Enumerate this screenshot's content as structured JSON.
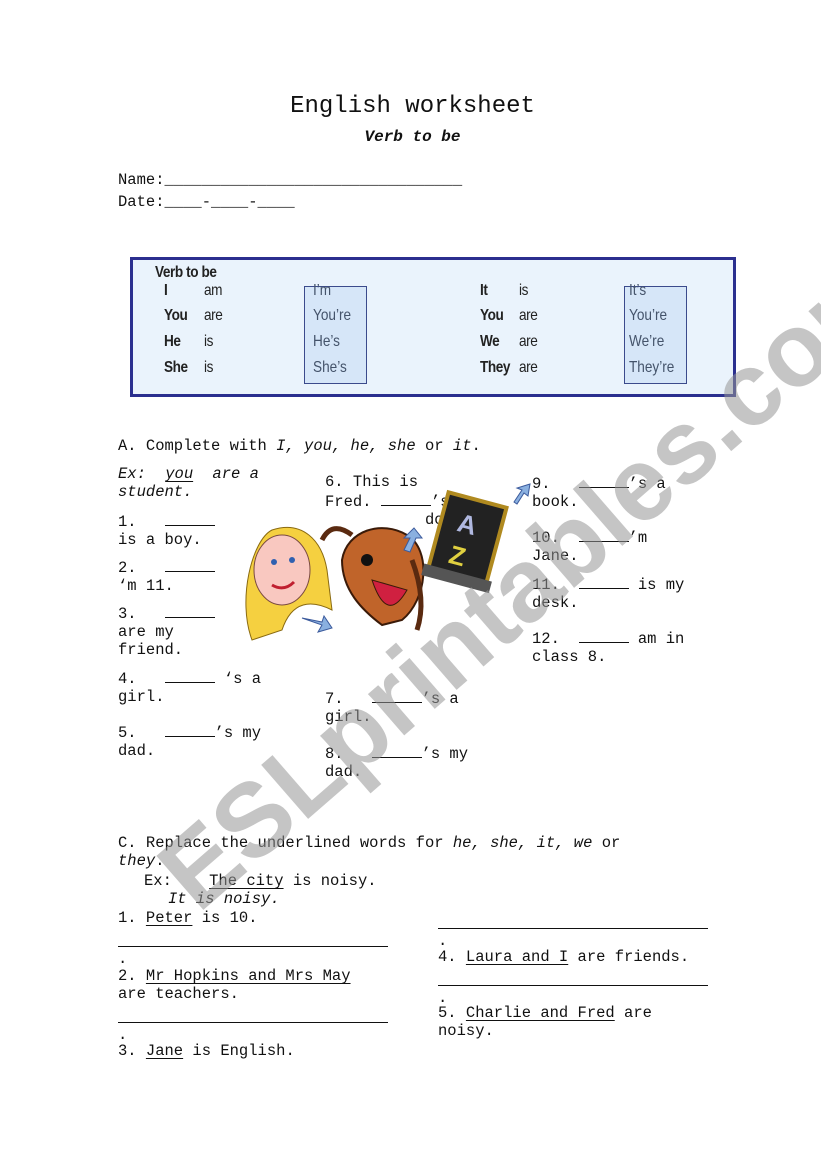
{
  "header": {
    "title": "English worksheet",
    "subtitle": "Verb to be"
  },
  "fields": {
    "name": "Name:________________________________",
    "date": "Date:____-____-____"
  },
  "verb_table": {
    "heading": "Verb to be",
    "left": [
      {
        "p": "I",
        "v": "am",
        "c": "I’m"
      },
      {
        "p": "You",
        "v": "are",
        "c": "You’re"
      },
      {
        "p": "He",
        "v": "is",
        "c": "He’s"
      },
      {
        "p": "She",
        "v": "is",
        "c": "She’s"
      }
    ],
    "right": [
      {
        "p": "It",
        "v": "is",
        "c": "It’s"
      },
      {
        "p": "You",
        "v": "are",
        "c": "You’re"
      },
      {
        "p": "We",
        "v": "are",
        "c": "We’re"
      },
      {
        "p": "They",
        "v": "are",
        "c": "They’re"
      }
    ],
    "colors": {
      "border": "#2b2f8f",
      "background": "#eaf3fc",
      "contraction_box": "#d6e6f8"
    }
  },
  "section_a": {
    "heading_pre": "A. Complete with ",
    "heading_words": "I, you, he, she",
    "heading_mid": " or ",
    "heading_last": "it",
    "heading_end": ".",
    "example": {
      "prefix": "Ex: ",
      "answer": "you",
      "rest": " are a",
      "line2": "student."
    },
    "items": {
      "i1": {
        "a": "1.",
        "b": "is a boy."
      },
      "i2": {
        "a": "2.",
        "b": "‘m 11."
      },
      "i3": {
        "a": "3.",
        "b": "are my",
        "c": "friend."
      },
      "i4": {
        "a": "4.",
        "a2": " ‘s a",
        "b": "girl."
      },
      "i5": {
        "a": "5.",
        "a2": "’s my",
        "b": "dad."
      },
      "i6": {
        "a": "6.  This is",
        "b": "Fred. ",
        "b2": "’s",
        "c": "do"
      },
      "i7": {
        "a": "7.",
        "a2": "’s a",
        "b": "girl."
      },
      "i8": {
        "a": "8.",
        "a2": "’s my",
        "b": "dad."
      },
      "i9": {
        "a": "9.",
        "a2": "’s a",
        "b": "book."
      },
      "i10": {
        "a": "10.",
        "a2": "’m",
        "b": "Jane."
      },
      "i11": {
        "a": "11.",
        "a2": " is my",
        "b": "desk."
      },
      "i12": {
        "a": "12.",
        "a2": " am in",
        "b": "class 8."
      }
    }
  },
  "section_c": {
    "heading_pre": "C. Replace the underlined words for ",
    "heading_words": "he, she, it, we",
    "heading_mid": " or",
    "heading_last": "they",
    "example": {
      "label": "Ex:",
      "underlined": "The city",
      "rest": " is noisy.",
      "answer": "It is noisy."
    },
    "items": [
      {
        "num": "1. ",
        "underlined": "Peter",
        "rest": " is 10."
      },
      {
        "num": "2. ",
        "underlined": "Mr Hopkins and Mrs May",
        "rest": "are teachers."
      },
      {
        "num": "3. ",
        "underlined": "Jane",
        "rest": " is English."
      },
      {
        "num": "4. ",
        "underlined": "Laura and I",
        "rest": " are friends."
      },
      {
        "num": "5. ",
        "underlined": "Charlie and Fred",
        "rest": " are",
        "rest2": "noisy."
      }
    ],
    "dot": "."
  },
  "watermark": "ESLprintables.com",
  "images": [
    "girl-clipart",
    "dog-clipart",
    "dictionary-book-clipart"
  ]
}
